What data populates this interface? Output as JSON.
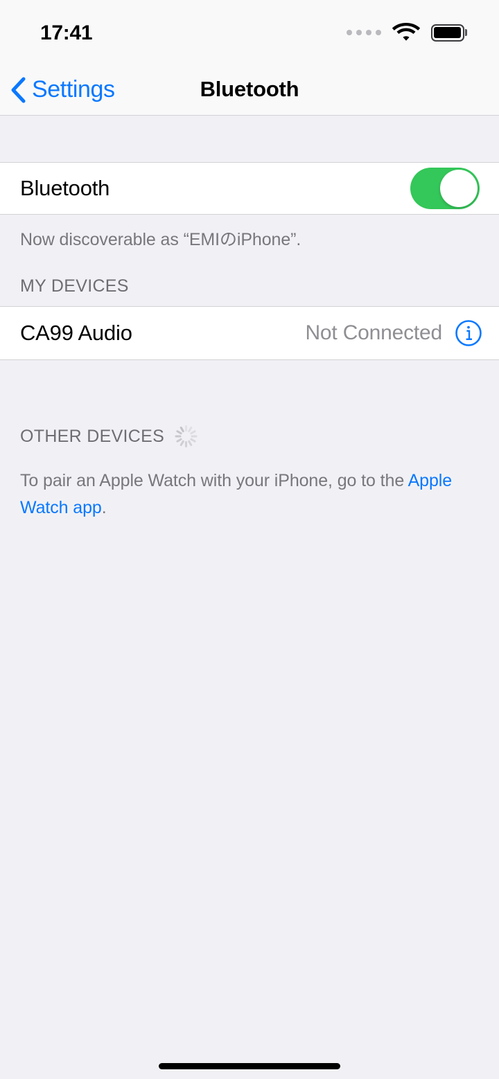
{
  "status_bar": {
    "time": "17:41",
    "signal_icon": "signal-dots-icon",
    "wifi_icon": "wifi-icon",
    "battery_icon": "battery-full-icon"
  },
  "nav": {
    "back_icon": "chevron-left-icon",
    "back_label": "Settings",
    "title": "Bluetooth"
  },
  "bluetooth_row": {
    "label": "Bluetooth",
    "toggle_state": "on",
    "toggle_color": "#34C759"
  },
  "discoverable_note": "Now discoverable as “EMIのiPhone”.",
  "my_devices": {
    "header": "MY DEVICES",
    "devices": [
      {
        "name": "CA99 Audio",
        "status": "Not Connected",
        "info_icon": "info-circle-icon"
      }
    ]
  },
  "other_devices": {
    "header": "OTHER DEVICES",
    "spinner_icon": "activity-spinner-icon",
    "footer": {
      "before_link": "To pair an Apple Watch with your iPhone, go to the ",
      "link": "Apple Watch app",
      "after_link": "."
    }
  },
  "home_indicator": "home-indicator",
  "colors": {
    "accent_blue": "#0A78FF",
    "toggle_green": "#34C759",
    "group_background": "#F1F1F5",
    "cell_background": "#FFFFFF",
    "secondary_text": "#8E8E93"
  }
}
